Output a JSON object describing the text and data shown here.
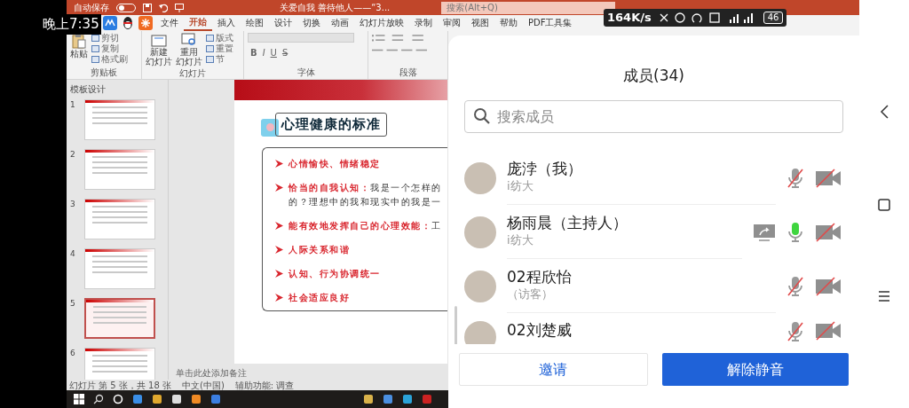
{
  "status_bar": {
    "time": "晚上7:35",
    "network_speed": "164K/s",
    "battery": "46"
  },
  "presentation": {
    "autosave_label": "自动保存",
    "autosave_on": false,
    "document_title": "关爱自我 善待他人——“3...",
    "search_placeholder": "搜索(Alt+Q)",
    "menu_tabs": [
      {
        "label": "文件",
        "selected": false
      },
      {
        "label": "开始",
        "selected": true
      },
      {
        "label": "插入",
        "selected": false
      },
      {
        "label": "绘图",
        "selected": false
      },
      {
        "label": "设计",
        "selected": false
      },
      {
        "label": "切换",
        "selected": false
      },
      {
        "label": "动画",
        "selected": false
      },
      {
        "label": "幻灯片放映",
        "selected": false
      },
      {
        "label": "录制",
        "selected": false
      },
      {
        "label": "审阅",
        "selected": false
      },
      {
        "label": "视图",
        "selected": false
      },
      {
        "label": "帮助",
        "selected": false
      },
      {
        "label": "PDF工具集",
        "selected": false
      }
    ],
    "ribbon_groups": [
      {
        "label": "剪贴板",
        "big_button": "粘贴",
        "small_buttons": [
          "剪切",
          "复制",
          "格式刷"
        ]
      },
      {
        "label": "幻灯片",
        "big_buttons": [
          {
            "lines": [
              "新建",
              "幻灯片"
            ]
          },
          {
            "lines": [
              "重用",
              "幻灯片"
            ]
          }
        ],
        "small_buttons": [
          "版式",
          "重置",
          "节"
        ]
      },
      {
        "label": "字体",
        "format_buttons": [
          "B",
          "I",
          "U",
          "S"
        ]
      },
      {
        "label": "段落"
      }
    ],
    "thumbnail_section": "模板设计",
    "thumbnails": [
      {
        "number": "1",
        "selected": false
      },
      {
        "number": "2",
        "selected": false
      },
      {
        "number": "3",
        "selected": false
      },
      {
        "number": "4",
        "selected": false
      },
      {
        "number": "5",
        "selected": true
      },
      {
        "number": "6",
        "selected": false
      }
    ],
    "slide": {
      "title": "心理健康的标准",
      "points": [
        {
          "lead": "心情愉快、情绪稳定"
        },
        {
          "lead": "恰当的自我认知：",
          "rest": "我是一个怎样的",
          "continuation": "的？理想中的我和现实中的我是一"
        },
        {
          "lead": "能有效地发挥自己的心理效能：",
          "rest": "工"
        },
        {
          "lead": "人际关系和谐"
        },
        {
          "lead": "认知、行为协调统一"
        },
        {
          "lead": "社会适应良好"
        }
      ]
    },
    "notes_placeholder": "单击此处添加备注",
    "status": {
      "slide_position": "幻灯片 第 5 张，共 18 张",
      "language": "中文(中国)",
      "accessibility": "辅助功能: 调查"
    }
  },
  "members_panel": {
    "title": "成员(34)",
    "search_placeholder": "搜索成员",
    "members": [
      {
        "name": "庞浡（我）",
        "subtitle": "i纺大",
        "sharing": false,
        "mic_on": false,
        "camera_on": false
      },
      {
        "name": "杨雨晨（主持人）",
        "subtitle": "i纺大",
        "sharing": true,
        "mic_on": true,
        "camera_on": false
      },
      {
        "name": "02程欣怡",
        "subtitle": "（访客）",
        "sharing": false,
        "mic_on": false,
        "camera_on": false
      },
      {
        "name": "02刘楚威",
        "sharing": false,
        "mic_on": false,
        "camera_on": false
      }
    ],
    "buttons": [
      {
        "label": "邀请",
        "kind": "secondary"
      },
      {
        "label": "解除静音",
        "kind": "primary"
      }
    ]
  }
}
